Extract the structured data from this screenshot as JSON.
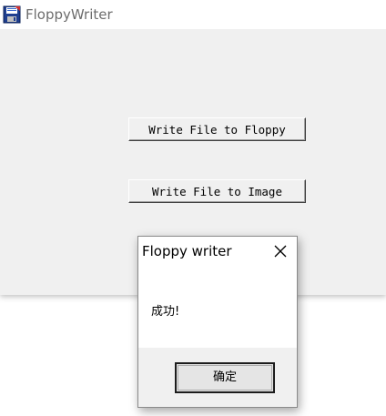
{
  "window": {
    "title": "FloppyWriter",
    "icon": "floppy-disk-icon"
  },
  "buttons": {
    "write_to_floppy": "Write File to Floppy",
    "write_to_image": "Write File to Image"
  },
  "dialog": {
    "title": "Floppy writer",
    "message": "成功!",
    "ok_label": "确定",
    "close_icon": "close-icon"
  }
}
